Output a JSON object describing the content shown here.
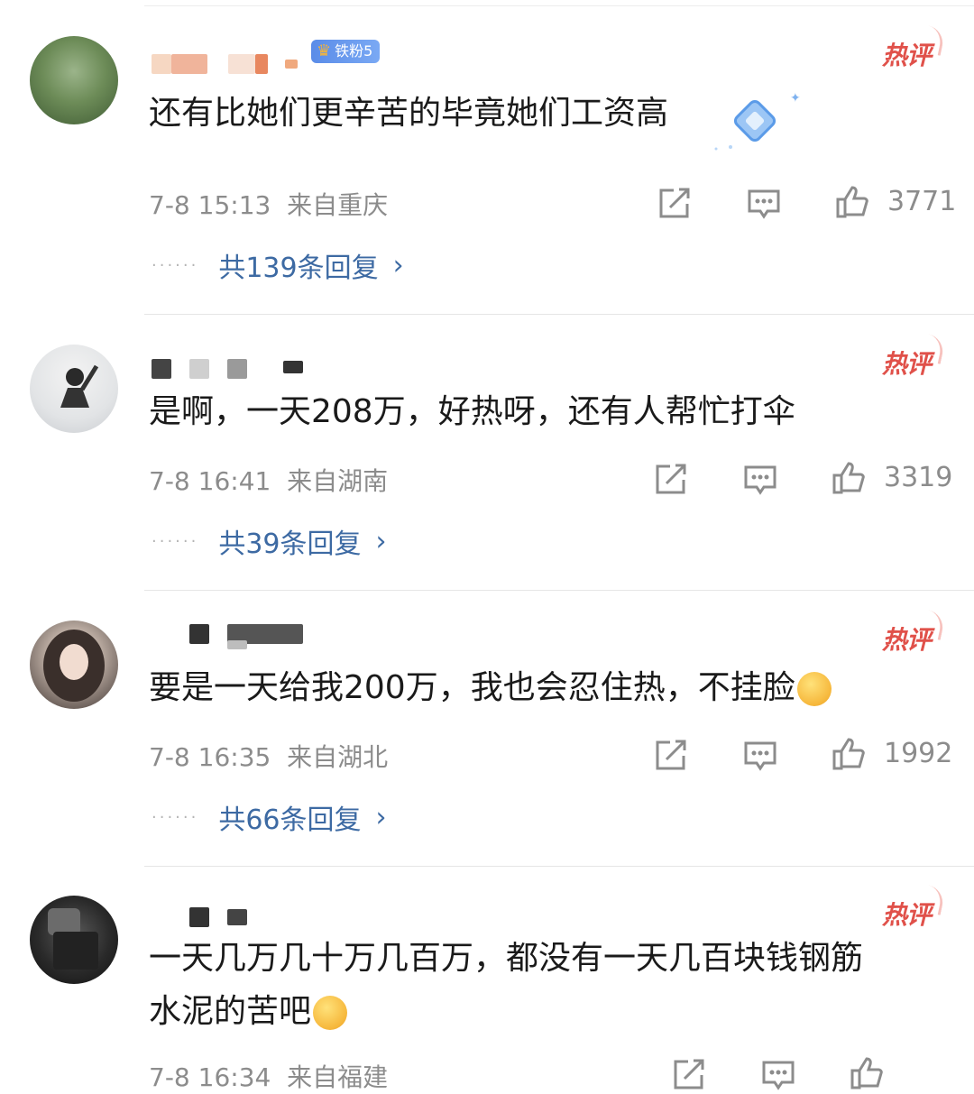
{
  "comments": [
    {
      "fan_badge": "铁粉5",
      "hot_label": "热评",
      "text": "还有比她们更辛苦的毕竟她们工资高",
      "time": "7-8 15:13",
      "location": "来自重庆",
      "likes": "3771",
      "replies": "共139条回复"
    },
    {
      "hot_label": "热评",
      "text": "是啊，一天208万，好热呀，还有人帮忙打伞",
      "time": "7-8 16:41",
      "location": "来自湖南",
      "likes": "3319",
      "replies": "共39条回复"
    },
    {
      "hot_label": "热评",
      "text": "要是一天给我200万，我也会忍住热，不挂脸",
      "emoji": "smirk-face-emoji",
      "time": "7-8 16:35",
      "location": "来自湖北",
      "likes": "1992",
      "replies": "共66条回复"
    },
    {
      "hot_label": "热评",
      "text_line1": "一天几万几十万几百万，都没有一天几百块钱钢筋",
      "text_line2": "水泥的苦吧",
      "emoji": "crying-face-emoji",
      "time": "7-8 16:34",
      "location": "来自福建"
    }
  ],
  "icons": {
    "share": "share-icon",
    "comment": "comment-icon",
    "like": "thumbs-up-icon"
  },
  "colors": {
    "hot": "#e0514a",
    "reply_link": "#3d6aa3",
    "meta_gray": "#8c8c8c",
    "badge_blue": "#5a8ce8"
  }
}
